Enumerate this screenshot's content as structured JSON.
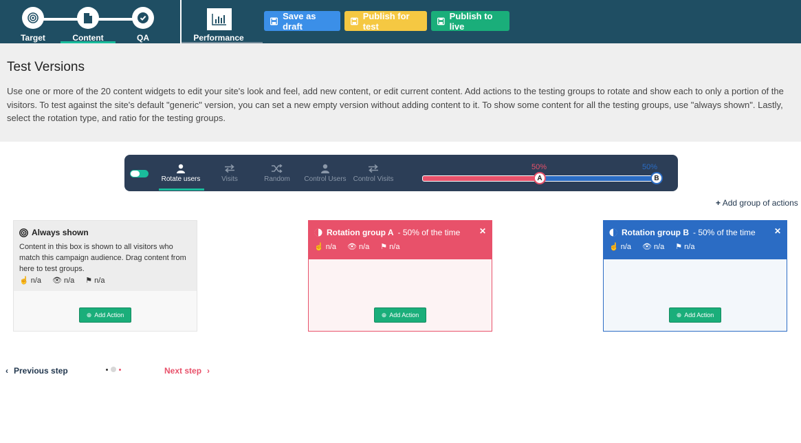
{
  "wizard": {
    "steps": [
      {
        "label": "Target",
        "icon": "target-icon"
      },
      {
        "label": "Content",
        "icon": "document-icon"
      },
      {
        "label": "QA",
        "icon": "check-circle-icon"
      }
    ],
    "performance_label": "Performance"
  },
  "toolbar": {
    "save_draft": "Save as draft",
    "publish_test": "Publish for test",
    "publish_live": "Publish to live"
  },
  "intro": {
    "title": "Test Versions",
    "description": "Use one or more of the 20 content widgets to edit your site's look and feel, add new content, or edit current content. Add actions to the testing groups to rotate and show each to only a portion of the visitors. To test against the site's default \"generic\" version, you can set a new empty version without adding content to it. To show some content for all the testing groups, use \"always shown\". Lastly, select the rotation type, and ratio for the testing groups."
  },
  "rotation": {
    "tabs": [
      "Rotate users",
      "Visits",
      "Random",
      "Control Users",
      "Control Visits"
    ],
    "active_tab": "Rotate users",
    "ratio_a_label": "50%",
    "ratio_b_label": "50%",
    "ratio_a": 0.5,
    "handle_a": "A",
    "handle_b": "B",
    "colors": {
      "a": "#e8516a",
      "b": "#2b6cc4",
      "accent": "#1abc9c"
    }
  },
  "add_group_label": "Add group of actions",
  "always_shown": {
    "title": "Always shown",
    "description": "Content in this box is shown to all visitors who match this campaign audience. Drag content from here to test groups.",
    "stats": [
      "n/a",
      "n/a",
      "n/a"
    ],
    "add_label": "Add Action"
  },
  "group_a": {
    "title": "Rotation group A",
    "subtitle": "- 50% of the time",
    "stats": [
      "n/a",
      "n/a",
      "n/a"
    ],
    "add_label": "Add Action"
  },
  "group_b": {
    "title": "Rotation group B",
    "subtitle": "- 50% of the time",
    "stats": [
      "n/a",
      "n/a",
      "n/a"
    ],
    "add_label": "Add Action"
  },
  "nav": {
    "previous": "Previous step",
    "next": "Next step"
  }
}
